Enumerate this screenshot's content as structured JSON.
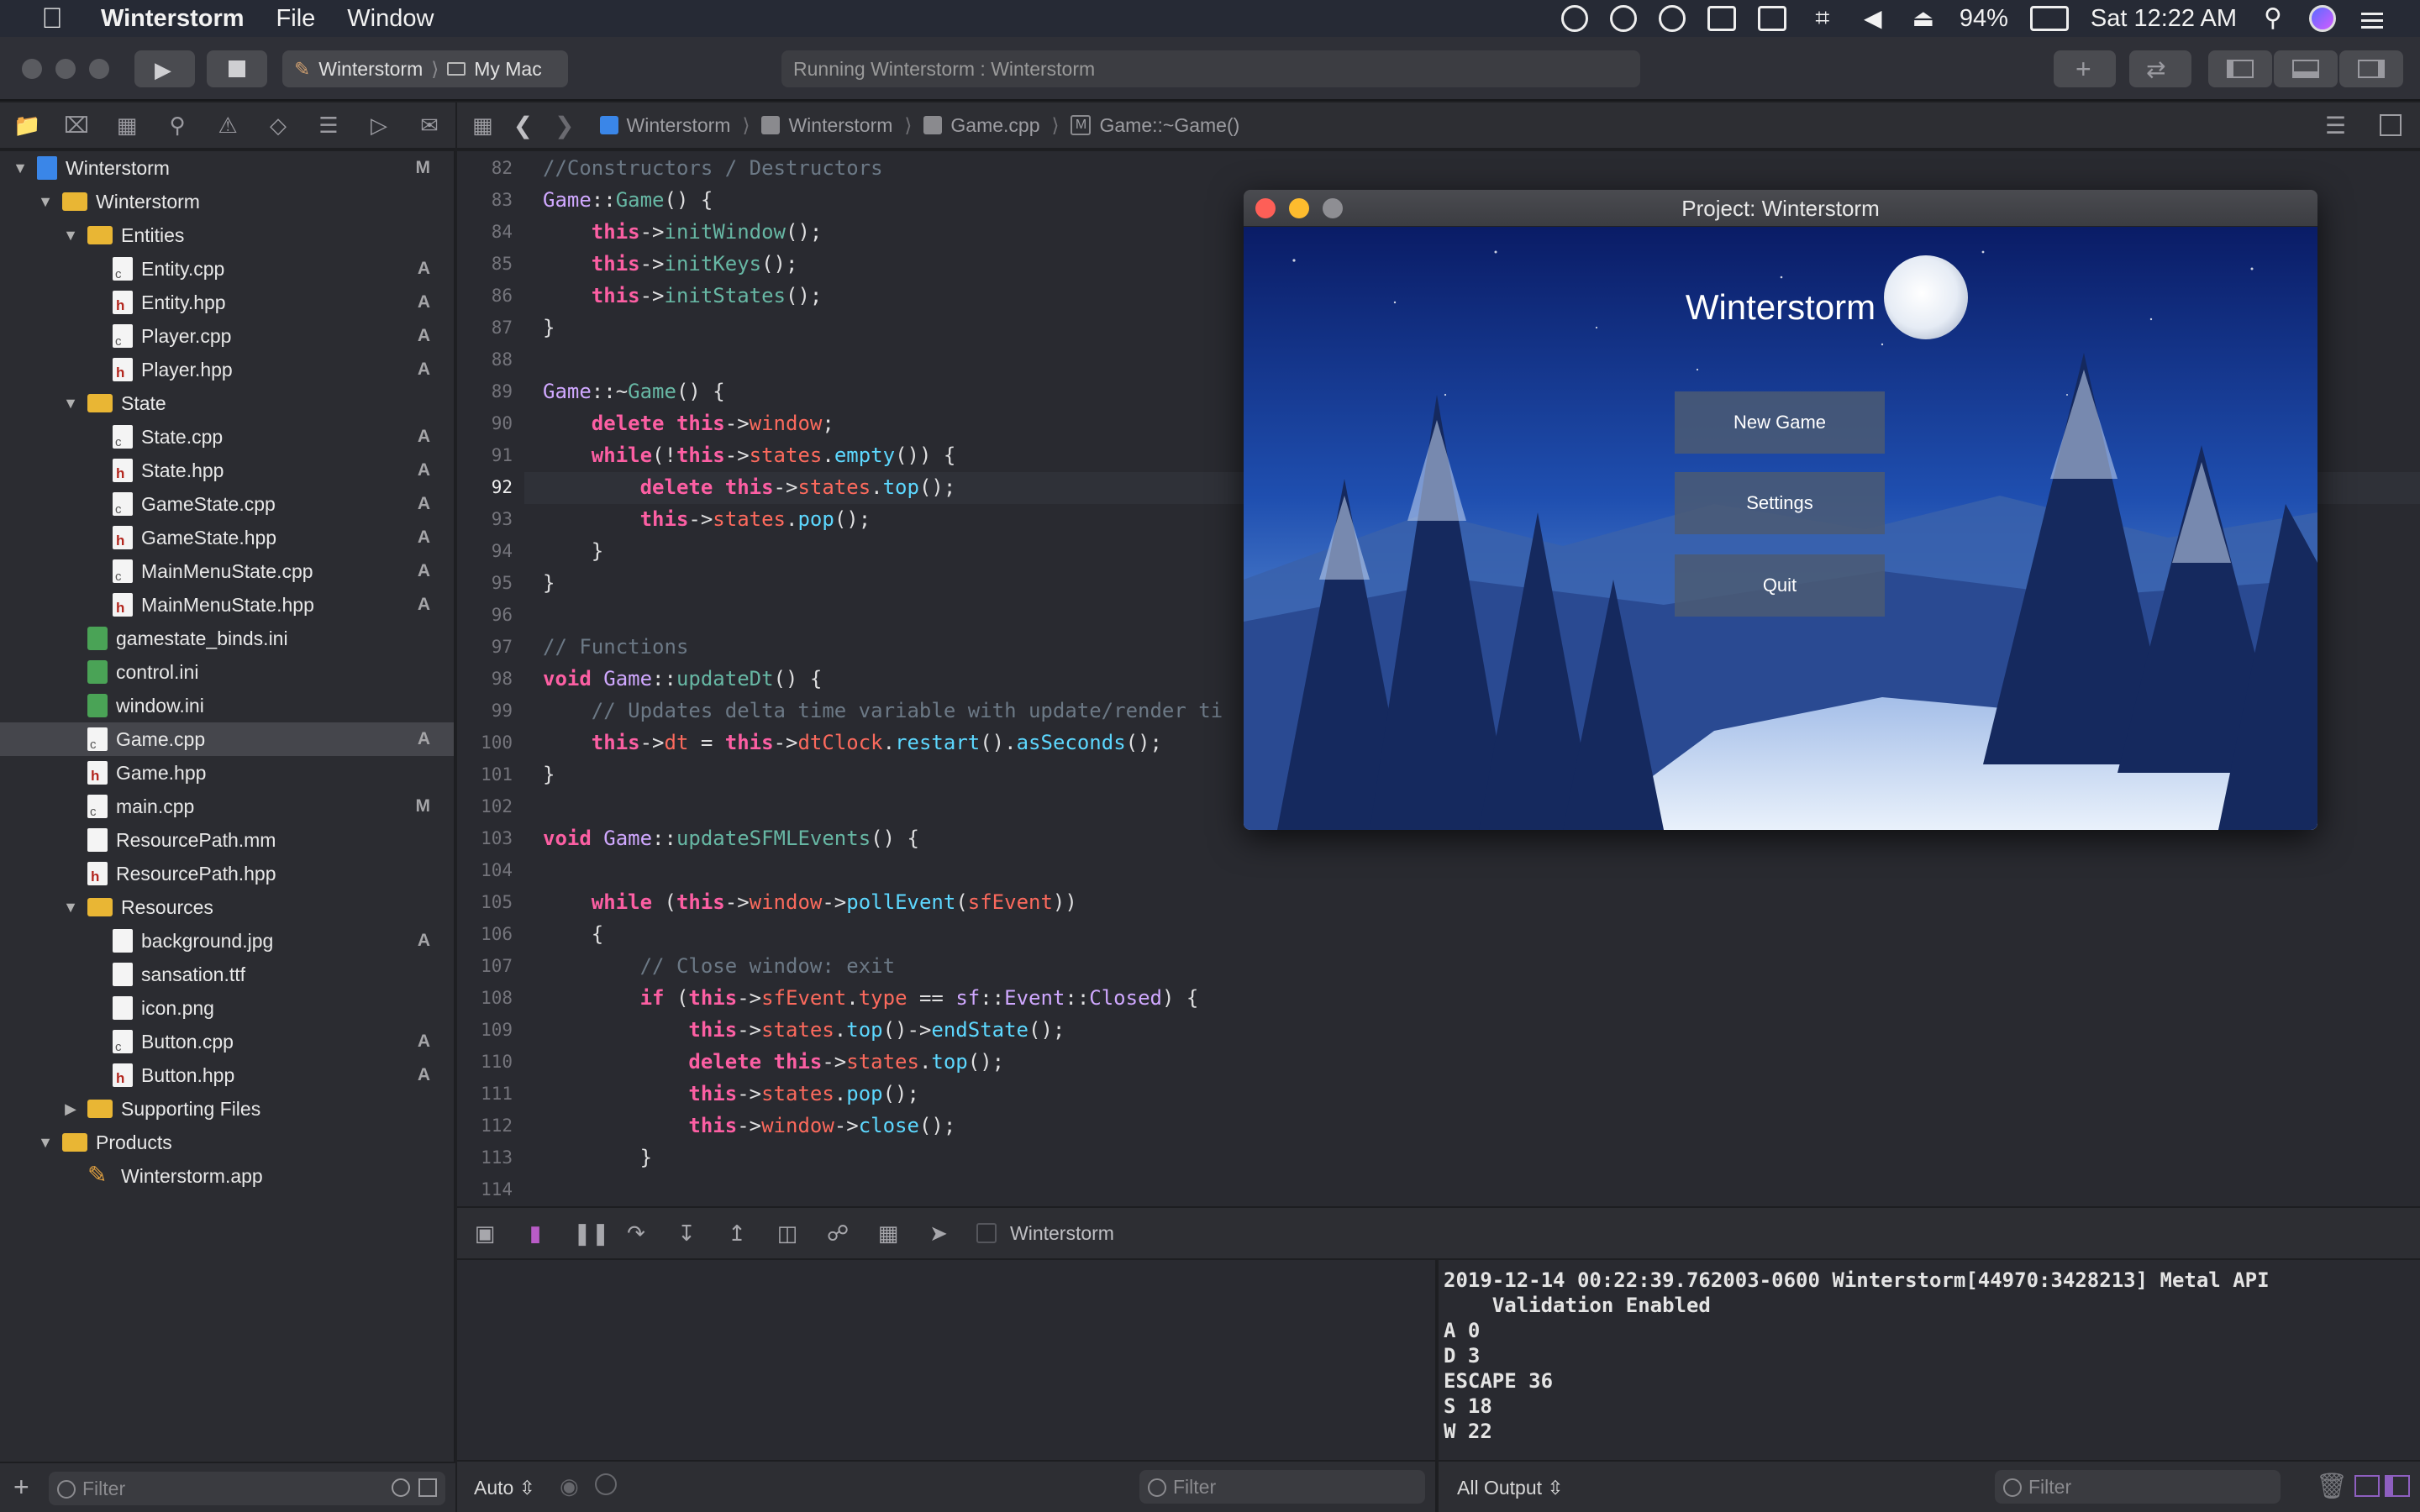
{
  "menubar": {
    "app_name": "Winterstorm",
    "items": [
      "File",
      "Window"
    ],
    "battery": "94%",
    "clock": "Sat 12:22 AM"
  },
  "toolbar": {
    "scheme_target": "Winterstorm",
    "scheme_device": "My Mac",
    "status": "Running Winterstorm : Winterstorm"
  },
  "navigator": {
    "rows": [
      {
        "label": "Winterstorm",
        "type": "proj",
        "depth": 0,
        "expanded": true,
        "badge": "M"
      },
      {
        "label": "Winterstorm",
        "type": "folder",
        "depth": 1,
        "expanded": true,
        "badge": ""
      },
      {
        "label": "Entities",
        "type": "folder",
        "depth": 2,
        "expanded": true,
        "badge": ""
      },
      {
        "label": "Entity.cpp",
        "type": "cpp",
        "depth": 3,
        "badge": "A"
      },
      {
        "label": "Entity.hpp",
        "type": "hpp",
        "depth": 3,
        "badge": "A"
      },
      {
        "label": "Player.cpp",
        "type": "cpp",
        "depth": 3,
        "badge": "A"
      },
      {
        "label": "Player.hpp",
        "type": "hpp",
        "depth": 3,
        "badge": "A"
      },
      {
        "label": "State",
        "type": "folder",
        "depth": 2,
        "expanded": true,
        "badge": ""
      },
      {
        "label": "State.cpp",
        "type": "cpp",
        "depth": 3,
        "badge": "A"
      },
      {
        "label": "State.hpp",
        "type": "hpp",
        "depth": 3,
        "badge": "A"
      },
      {
        "label": "GameState.cpp",
        "type": "cpp",
        "depth": 3,
        "badge": "A"
      },
      {
        "label": "GameState.hpp",
        "type": "hpp",
        "depth": 3,
        "badge": "A"
      },
      {
        "label": "MainMenuState.cpp",
        "type": "cpp",
        "depth": 3,
        "badge": "A"
      },
      {
        "label": "MainMenuState.hpp",
        "type": "hpp",
        "depth": 3,
        "badge": "A"
      },
      {
        "label": "gamestate_binds.ini",
        "type": "ini",
        "depth": 2,
        "badge": ""
      },
      {
        "label": "control.ini",
        "type": "ini",
        "depth": 2,
        "badge": ""
      },
      {
        "label": "window.ini",
        "type": "ini",
        "depth": 2,
        "badge": ""
      },
      {
        "label": "Game.cpp",
        "type": "cpp",
        "depth": 2,
        "badge": "A",
        "selected": true
      },
      {
        "label": "Game.hpp",
        "type": "hpp",
        "depth": 2,
        "badge": ""
      },
      {
        "label": "main.cpp",
        "type": "cpp",
        "depth": 2,
        "badge": "M"
      },
      {
        "label": "ResourcePath.mm",
        "type": "mm",
        "depth": 2,
        "badge": ""
      },
      {
        "label": "ResourcePath.hpp",
        "type": "hpp",
        "depth": 2,
        "badge": ""
      },
      {
        "label": "Resources",
        "type": "folder",
        "depth": 2,
        "expanded": true,
        "badge": ""
      },
      {
        "label": "background.jpg",
        "type": "img",
        "depth": 3,
        "badge": "A"
      },
      {
        "label": "sansation.ttf",
        "type": "img",
        "depth": 3,
        "badge": ""
      },
      {
        "label": "icon.png",
        "type": "img",
        "depth": 3,
        "badge": ""
      },
      {
        "label": "Button.cpp",
        "type": "cpp",
        "depth": 3,
        "badge": "A"
      },
      {
        "label": "Button.hpp",
        "type": "hpp",
        "depth": 3,
        "badge": "A"
      },
      {
        "label": "Supporting Files",
        "type": "folder",
        "depth": 2,
        "expanded": false,
        "badge": ""
      },
      {
        "label": "Products",
        "type": "folder",
        "depth": 1,
        "expanded": true,
        "badge": ""
      },
      {
        "label": "Winterstorm.app",
        "type": "app",
        "depth": 2,
        "badge": ""
      }
    ],
    "filter_placeholder": "Filter"
  },
  "jumpbar": {
    "crumbs": [
      "Winterstorm",
      "Winterstorm",
      "Game.cpp",
      "Game::~Game()"
    ]
  },
  "editor": {
    "current_line": 92,
    "lines": [
      {
        "n": 82,
        "html": "<span class='cm'>//Constructors / Destructors</span>"
      },
      {
        "n": 83,
        "html": "<span class='cl'>Game</span>::<span class='fn'>Game</span>() {"
      },
      {
        "n": 84,
        "html": "    <span class='kw'>this</span>-&gt;<span class='fn'>initWindow</span>();"
      },
      {
        "n": 85,
        "html": "    <span class='kw'>this</span>-&gt;<span class='fn'>initKeys</span>();"
      },
      {
        "n": 86,
        "html": "    <span class='kw'>this</span>-&gt;<span class='fn'>initStates</span>();"
      },
      {
        "n": 87,
        "html": "}"
      },
      {
        "n": 88,
        "html": ""
      },
      {
        "n": 89,
        "html": "<span class='cl'>Game</span>::~<span class='fn'>Game</span>() {"
      },
      {
        "n": 90,
        "html": "    <span class='kw'>delete</span> <span class='kw'>this</span>-&gt;<span class='mb'>window</span>;"
      },
      {
        "n": 91,
        "html": "    <span class='kw'>while</span>(!<span class='kw'>this</span>-&gt;<span class='mb'>states</span>.<span class='fnu'>empty</span>()) {"
      },
      {
        "n": 92,
        "html": "        <span class='kw'>delete</span> <span class='kw'>this</span>-&gt;<span class='mb'>states</span>.<span class='fnu'>top</span>();"
      },
      {
        "n": 93,
        "html": "        <span class='kw'>this</span>-&gt;<span class='mb'>states</span>.<span class='fnu'>pop</span>();"
      },
      {
        "n": 94,
        "html": "    }"
      },
      {
        "n": 95,
        "html": "}"
      },
      {
        "n": 96,
        "html": ""
      },
      {
        "n": 97,
        "html": "<span class='cm'>// Functions</span>"
      },
      {
        "n": 98,
        "html": "<span class='kw'>void</span> <span class='cl'>Game</span>::<span class='fn'>updateDt</span>() {"
      },
      {
        "n": 99,
        "html": "    <span class='cm'>// Updates delta time variable with update/render ti</span>"
      },
      {
        "n": 100,
        "html": "    <span class='kw'>this</span>-&gt;<span class='mb'>dt</span> = <span class='kw'>this</span>-&gt;<span class='mb'>dtClock</span>.<span class='fnu'>restart</span>().<span class='fnu'>asSeconds</span>();"
      },
      {
        "n": 101,
        "html": "}"
      },
      {
        "n": 102,
        "html": ""
      },
      {
        "n": 103,
        "html": "<span class='kw'>void</span> <span class='cl'>Game</span>::<span class='fn'>updateSFMLEvents</span>() {"
      },
      {
        "n": 104,
        "html": ""
      },
      {
        "n": 105,
        "html": "    <span class='kw'>while</span> (<span class='kw'>this</span>-&gt;<span class='mb'>window</span>-&gt;<span class='fnu'>pollEvent</span>(<span class='mb'>sfEvent</span>))"
      },
      {
        "n": 106,
        "html": "    {"
      },
      {
        "n": 107,
        "html": "        <span class='cm'>// Close window: exit</span>"
      },
      {
        "n": 108,
        "html": "        <span class='kw'>if</span> (<span class='kw'>this</span>-&gt;<span class='mb'>sfEvent</span>.<span class='mb'>type</span> == <span class='cl'>sf</span>::<span class='cl'>Event</span>::<span class='cl'>Closed</span>) {"
      },
      {
        "n": 109,
        "html": "            <span class='kw'>this</span>-&gt;<span class='mb'>states</span>.<span class='fnu'>top</span>()-&gt;<span class='fnu'>endState</span>();"
      },
      {
        "n": 110,
        "html": "            <span class='kw'>delete</span> <span class='kw'>this</span>-&gt;<span class='mb'>states</span>.<span class='fnu'>top</span>();"
      },
      {
        "n": 111,
        "html": "            <span class='kw'>this</span>-&gt;<span class='mb'>states</span>.<span class='fnu'>pop</span>();"
      },
      {
        "n": 112,
        "html": "            <span class='kw'>this</span>-&gt;<span class='mb'>window</span>-&gt;<span class='fnu'>close</span>();"
      },
      {
        "n": 113,
        "html": "        }"
      },
      {
        "n": 114,
        "html": ""
      }
    ]
  },
  "game_window": {
    "title": "Project: Winterstorm",
    "game_title": "Winterstorm",
    "buttons": [
      "New Game",
      "Settings",
      "Quit"
    ]
  },
  "debugbar": {
    "process": "Winterstorm"
  },
  "variables": {
    "scope": "Auto",
    "filter_placeholder": "Filter"
  },
  "console": {
    "lines": [
      "2019-12-14 00:22:39.762003-0600 Winterstorm[44970:3428213] Metal API",
      "    Validation Enabled",
      "A 0",
      "D 3",
      "ESCAPE 36",
      "S 18",
      "W 22"
    ],
    "output_mode": "All Output",
    "filter_placeholder": "Filter"
  },
  "colors": {
    "accent": "#3e8cf3",
    "close": "#fe5f57",
    "minimize": "#febc2e",
    "zoom": "#8e8e93"
  }
}
